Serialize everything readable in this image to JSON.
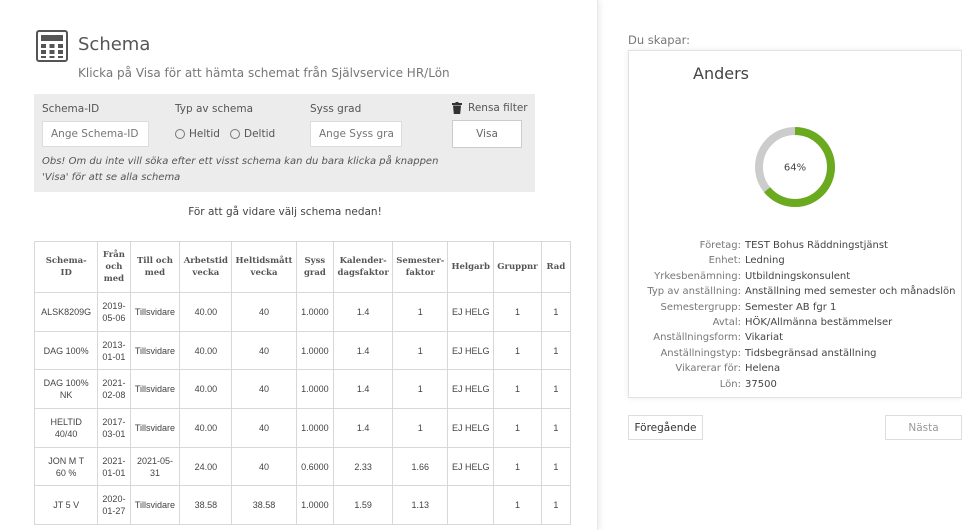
{
  "header": {
    "title": "Schema",
    "subtitle": "Klicka på Visa för att hämta schemat från Självservice HR/Lön",
    "icon": "calculator-icon"
  },
  "filters": {
    "schema_id_label": "Schema-ID",
    "schema_id_placeholder": "Ange Schema-ID",
    "typ_label": "Typ av schema",
    "typ_options": [
      "Heltid",
      "Deltid"
    ],
    "syss_label": "Syss grad",
    "syss_placeholder": "Ange Syss grad",
    "rensa_label": "Rensa filter",
    "visa_label": "Visa",
    "note": "Obs! Om du inte vill söka efter ett visst schema kan du bara klicka på knappen 'Visa' för att se alla schema"
  },
  "proceed_text": "För att gå vidare välj schema nedan!",
  "table": {
    "headers": [
      "Schema-\nID",
      "Från\noch\nmed",
      "Till och\nmed",
      "Arbetstid\nvecka",
      "Heltidsmått\nvecka",
      "Syss\ngrad",
      "Kalender-\ndagsfaktor",
      "Semester-\nfaktor",
      "Helgarb",
      "Gruppnr",
      "Rad"
    ],
    "rows": [
      [
        "ALSK8209G",
        "2019-\n05-06",
        "Tillsvidare",
        "40.00",
        "40",
        "1.0000",
        "1.4",
        "1",
        "EJ HELG",
        "1",
        "1"
      ],
      [
        "DAG 100%",
        "2013-\n01-01",
        "Tillsvidare",
        "40.00",
        "40",
        "1.0000",
        "1.4",
        "1",
        "EJ HELG",
        "1",
        "1"
      ],
      [
        "DAG 100%\nNK",
        "2021-\n02-08",
        "Tillsvidare",
        "40.00",
        "40",
        "1.0000",
        "1.4",
        "1",
        "EJ HELG",
        "1",
        "1"
      ],
      [
        "HELTID\n40/40",
        "2017-\n03-01",
        "Tillsvidare",
        "40.00",
        "40",
        "1.0000",
        "1.4",
        "1",
        "EJ HELG",
        "1",
        "1"
      ],
      [
        "JON M T\n60 %",
        "2021-\n01-01",
        "2021-05-\n31",
        "24.00",
        "40",
        "0.6000",
        "2.33",
        "1.66",
        "EJ HELG",
        "1",
        "1"
      ],
      [
        "JT 5 V",
        "2020-\n01-27",
        "Tillsvidare",
        "38.58",
        "38.58",
        "1.0000",
        "1.59",
        "1.13",
        "",
        "1",
        "1"
      ]
    ]
  },
  "creator": {
    "label": "Du skapar:",
    "name": "Anders",
    "progress_percent": 64,
    "progress_label": "64%",
    "colors": {
      "progress": "#6aaa1e",
      "track": "#cccccc"
    },
    "info": [
      {
        "k": "Företag:",
        "v": "TEST Bohus Räddningstjänst"
      },
      {
        "k": "Enhet:",
        "v": "Ledning"
      },
      {
        "k": "Yrkesbenämning:",
        "v": "Utbildningskonsulent"
      },
      {
        "k": "Typ av anställning:",
        "v": "Anställning med semester och månadslön"
      },
      {
        "k": "Semestergrupp:",
        "v": "Semester AB fgr 1"
      },
      {
        "k": "Avtal:",
        "v": "HÖK/Allmänna bestämmelser"
      },
      {
        "k": "Anställningsform:",
        "v": "Vikariat"
      },
      {
        "k": "Anställningstyp:",
        "v": "Tidsbegränsad anställning"
      },
      {
        "k": "Vikarerar för:",
        "v": "Helena"
      },
      {
        "k": "Lön:",
        "v": "37500"
      }
    ]
  },
  "nav": {
    "prev_label": "Föregående",
    "next_label": "Nästa"
  }
}
